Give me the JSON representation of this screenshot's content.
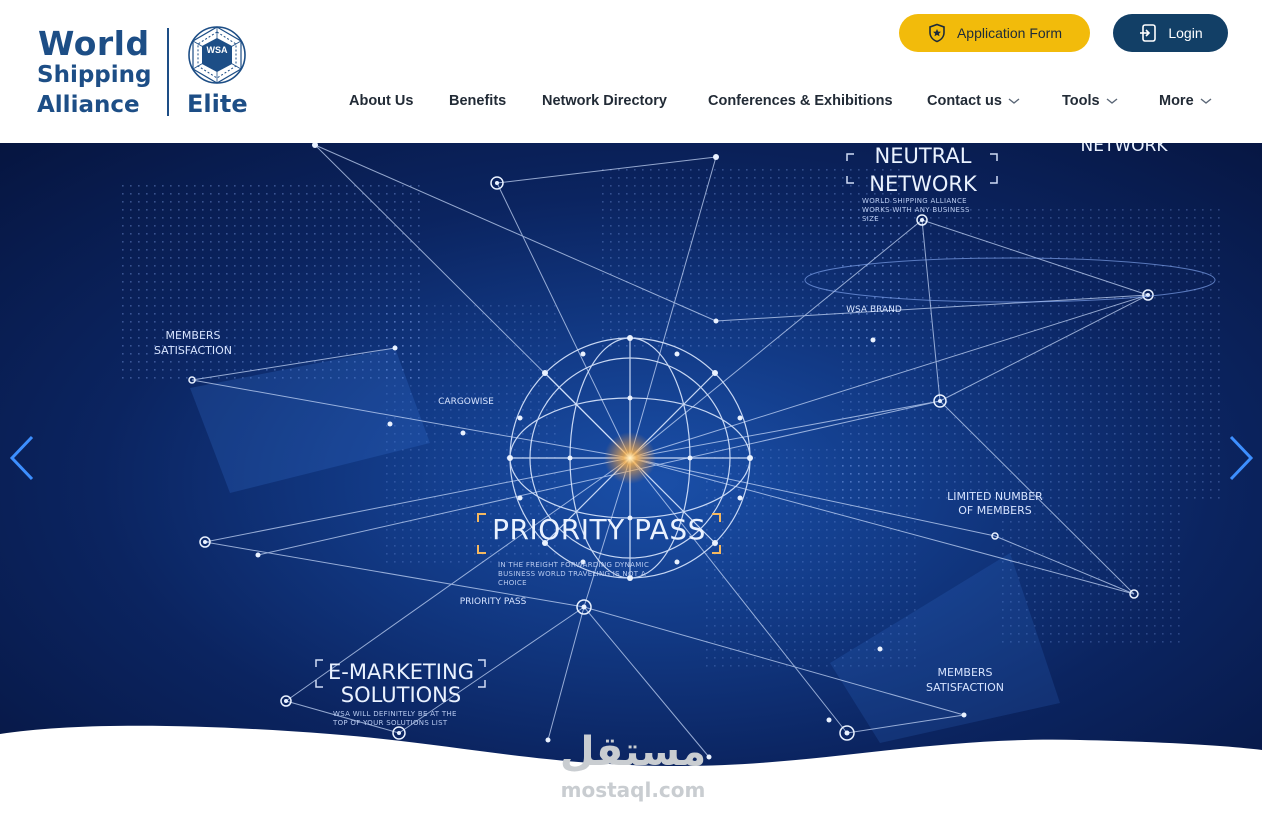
{
  "logo": {
    "line1": "World",
    "line2": "Shipping",
    "line3": "Alliance",
    "emblem_label": "WSA",
    "elite": "Elite",
    "brand_color": "#1d4e86"
  },
  "header": {
    "application_form_label": "Application Form",
    "application_form_icon": "shield-star-icon",
    "login_label": "Login",
    "login_icon": "login-icon",
    "accent_yellow": "#f2bb0b",
    "accent_navy": "#123f66"
  },
  "nav": {
    "items": [
      {
        "label": "About Us",
        "has_dropdown": false
      },
      {
        "label": "Benefits",
        "has_dropdown": false
      },
      {
        "label": "Network Directory",
        "has_dropdown": false
      },
      {
        "label": "Conferences & Exhibitions",
        "has_dropdown": false
      },
      {
        "label": "Contact us",
        "has_dropdown": true
      },
      {
        "label": "Tools",
        "has_dropdown": true
      },
      {
        "label": "More",
        "has_dropdown": true
      }
    ]
  },
  "hero": {
    "headline": "PRIORITY PASS",
    "headline_sub": "IN THE FREIGHT FORWARDING DYNAMIC BUSINESS WORLD TRAVELING IS NOT A CHOICE",
    "neutral_network_1": "NEUTRAL",
    "neutral_network_2": "NETWORK",
    "neutral_network_sub": "WORLD SHIPPING ALLIANCE WORKS WITH ANY BUSINESS SIZE",
    "network_top": "NETWORK",
    "emarketing_1": "E-MARKETING",
    "emarketing_2": "SOLUTIONS",
    "emarketing_sub": "WSA WILL DEFINITELY BE AT THE TOP OF YOUR SOLUTIONS LIST",
    "members_satisfaction_left": "MEMBERS SATISFACTION",
    "members_satisfaction_right": "MEMBERS SATISFACTION",
    "limited_number": "LIMITED NUMBER OF MEMBERS",
    "cargowise": "CARGOWISE",
    "wsa_brand": "WSA BRAND",
    "priority_pass_small": "PRIORITY PASS",
    "prev_icon": "chevron-left-icon",
    "next_icon": "chevron-right-icon"
  },
  "watermark": {
    "arabic": "مستقل",
    "latin": "mostaql.com"
  }
}
